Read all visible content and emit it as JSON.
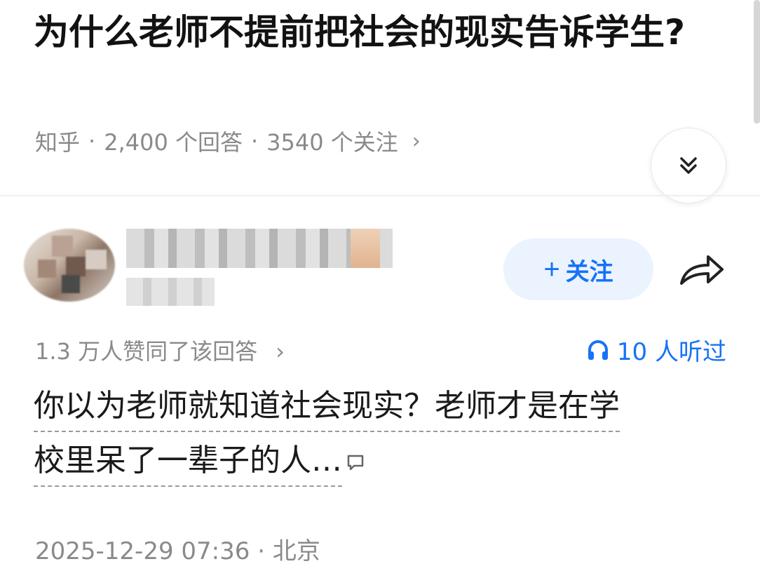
{
  "question": {
    "title": "为什么老师不提前把社会的现实告诉学生?",
    "source": "知乎",
    "answers_count": "2,400 个回答",
    "follow_count": "3540 个关注",
    "separator": "·",
    "chevron": "›"
  },
  "answer": {
    "follow_label": "关注",
    "follow_plus": "+",
    "upvote_text": "1.3 万人赞同了该回答",
    "upvote_chevron": "›",
    "listen_text": "10 人听过",
    "content_line1": "你以为老师就知道社会现实？老师才是在学",
    "content_line2": "校里呆了一辈子的人…",
    "timestamp": "2025-12-29 07:36",
    "location_sep": "·",
    "location": "北京"
  },
  "icons": {
    "collapse": "double-chevron-down-icon",
    "share": "share-arrow-icon",
    "headphones": "headphones-icon",
    "comment": "comment-bubble-icon"
  },
  "colors": {
    "accent": "#1772f6",
    "follow_bg": "#ebf3ff",
    "meta_gray": "#8a8a8a"
  }
}
